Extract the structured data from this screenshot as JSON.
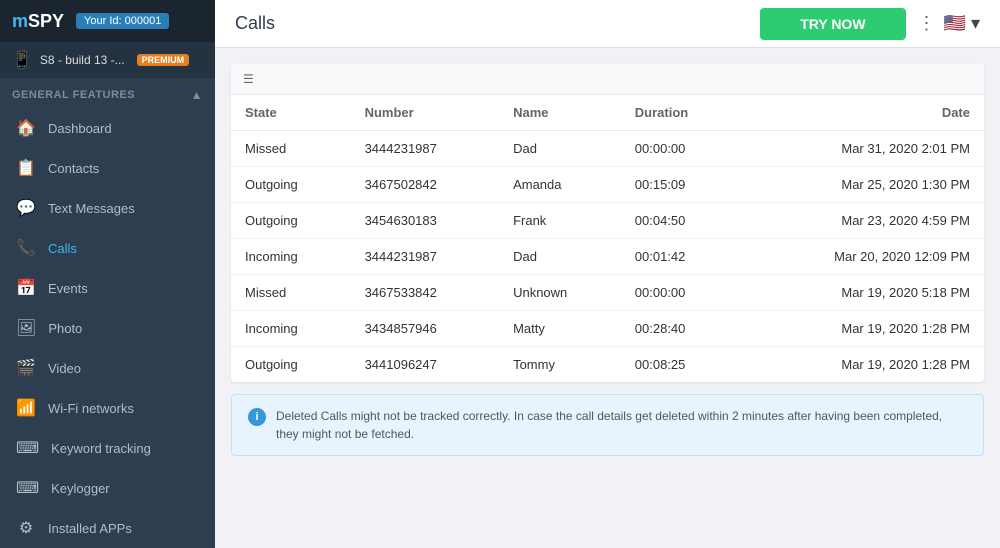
{
  "sidebar": {
    "logo": "mSPY",
    "user_id_label": "Your Id: 000001",
    "device_label": "S8 - build 13 -...",
    "premium_badge": "PREMIUM",
    "general_features_label": "GENERAL FEATURES",
    "nav_items": [
      {
        "id": "dashboard",
        "label": "Dashboard",
        "icon": "🏠"
      },
      {
        "id": "contacts",
        "label": "Contacts",
        "icon": "📋"
      },
      {
        "id": "text-messages",
        "label": "Text Messages",
        "icon": "💬"
      },
      {
        "id": "calls",
        "label": "Calls",
        "icon": "📞",
        "active": true
      },
      {
        "id": "events",
        "label": "Events",
        "icon": "📅"
      },
      {
        "id": "photo",
        "label": "Photo",
        "icon": "🖼"
      },
      {
        "id": "video",
        "label": "Video",
        "icon": "🎬"
      },
      {
        "id": "wifi-networks",
        "label": "Wi-Fi networks",
        "icon": "📶"
      },
      {
        "id": "keyword-tracking",
        "label": "Keyword tracking",
        "icon": "⌨"
      },
      {
        "id": "keylogger",
        "label": "Keylogger",
        "icon": "⌨"
      },
      {
        "id": "installed-apps",
        "label": "Installed APPs",
        "icon": "⚙"
      }
    ]
  },
  "header": {
    "title": "Calls",
    "try_now_label": "TRY NOW"
  },
  "table": {
    "columns": [
      "State",
      "Number",
      "Name",
      "Duration",
      "Date"
    ],
    "rows": [
      {
        "state": "Missed",
        "number": "3444231987",
        "name": "Dad",
        "duration": "00:00:00",
        "date": "Mar 31, 2020 2:01 PM"
      },
      {
        "state": "Outgoing",
        "number": "3467502842",
        "name": "Amanda",
        "duration": "00:15:09",
        "date": "Mar 25, 2020 1:30 PM"
      },
      {
        "state": "Outgoing",
        "number": "3454630183",
        "name": "Frank",
        "duration": "00:04:50",
        "date": "Mar 23, 2020 4:59 PM"
      },
      {
        "state": "Incoming",
        "number": "3444231987",
        "name": "Dad",
        "duration": "00:01:42",
        "date": "Mar 20, 2020 12:09 PM"
      },
      {
        "state": "Missed",
        "number": "3467533842",
        "name": "Unknown",
        "duration": "00:00:00",
        "date": "Mar 19, 2020 5:18 PM"
      },
      {
        "state": "Incoming",
        "number": "3434857946",
        "name": "Matty",
        "duration": "00:28:40",
        "date": "Mar 19, 2020 1:28 PM"
      },
      {
        "state": "Outgoing",
        "number": "3441096247",
        "name": "Tommy",
        "duration": "00:08:25",
        "date": "Mar 19, 2020 1:28 PM"
      }
    ]
  },
  "info_message": "Deleted Calls might not be tracked correctly. In case the call details get deleted within 2 minutes after having been completed, they might not be fetched."
}
